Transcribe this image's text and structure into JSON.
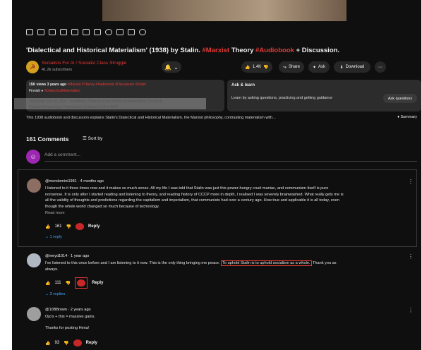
{
  "video": {
    "title_parts": [
      "'Dialectical and Historical Materialism' (1938) by Stalin. ",
      "#Marxist",
      " Theory ",
      "#Audiobook",
      " + Discussion."
    ]
  },
  "channel": {
    "name": "Socialists For AI / Socialist Class Struggle",
    "subscribers": "41.2k subscribers",
    "avatar_glyph": "☭"
  },
  "actions": {
    "bell_icon": "🔔",
    "like_count": "1.4K",
    "share_label": "Share",
    "ask_label": "Ask",
    "download_label": "Download"
  },
  "description": {
    "line1": "15K views  3 years ago",
    "line1_tags": " #Marxist #Theory #Audiobook #Discussion #Stalin",
    "line2": "Finnish  ♦  ",
    "line2_tag": "#DialecticalMaterialism",
    "line3": "Transcript: Jan 20, 2021 · Audiobook: Dialectical and Historical Materialism: Theory &",
    "line4": "Historic Archaeology / Translations to Spanish 1S al ADN",
    "summary_text": "This 1938 audiobook and discussion explains Stalin's Dialectical and Historical Materialism, the Marxist philosophy, contrasting materialism with...",
    "summary_btn": "♦ Summary"
  },
  "ask_panel": {
    "title": "Ask & learn",
    "subtitle": "Learn by asking questions, practicing and getting guidance",
    "button": "Ask questions"
  },
  "comments": {
    "count_label": "161 Comments",
    "sort_label": "Sort by",
    "add_placeholder": "Add a comment...",
    "items": [
      {
        "author": "@mondomini1981 · 4 months ago",
        "lines": [
          "I listened to it three times now and it makes so much sense. All my life I was told that Stalin was just this power-hungry cruel maniac, and communism itself is pure",
          "nonsense. It is only after I started reading and listening to theory, and reading history of CCCP more in depth, I realised I was severely brainwashed. What really gets me is",
          "all the validity of thoughts and predictions regarding the capitalism and imperialism, that communists had over a century ago. How true and applicable it is all today, even",
          "though the whole world changed so much because of technology."
        ],
        "read_more": "Read more",
        "likes": "161",
        "reply": "Reply",
        "replies": "⌄ 1 reply"
      },
      {
        "author": "@meyd1014 · 1 year ago",
        "line_before": "I've listened to this once before and I am listening to it now. This is the only thing bringing me peace. ",
        "line_highlight": "To uphold Stalin is to uphold socialism as a whole.",
        "line_after": " Thank you as",
        "line2": "always.",
        "likes": "111",
        "reply": "Reply",
        "replies": "⌄ 3 replies"
      },
      {
        "author": "@10BBrown · 2 years ago",
        "line1": "Ojo's + this = massive gains.",
        "line2": "Thanks for posting Hena!",
        "likes": "93",
        "reply": "Reply"
      }
    ]
  }
}
